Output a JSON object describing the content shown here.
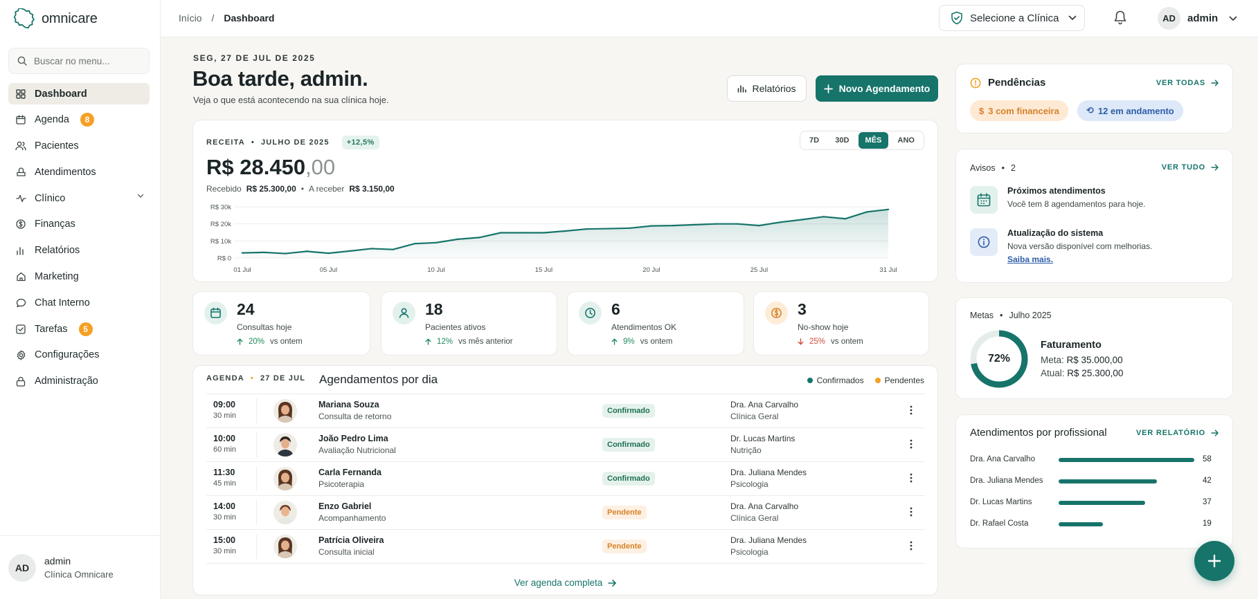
{
  "app": {
    "name": "omnicare"
  },
  "search": {
    "placeholder": "Buscar no menu..."
  },
  "nav": [
    {
      "label": "Dashboard",
      "icon": "grid-icon",
      "active": true
    },
    {
      "label": "Agenda",
      "icon": "calendar-icon",
      "badge": "8"
    },
    {
      "label": "Pacientes",
      "icon": "users-icon"
    },
    {
      "label": "Atendimentos",
      "icon": "stethoscope-icon"
    },
    {
      "label": "Clínico",
      "icon": "activity-icon",
      "expandable": true
    },
    {
      "label": "Finanças",
      "icon": "dollar-icon"
    },
    {
      "label": "Relatórios",
      "icon": "bar-chart-icon"
    },
    {
      "label": "Marketing",
      "icon": "megaphone-icon"
    },
    {
      "label": "Chat Interno",
      "icon": "chat-icon"
    },
    {
      "label": "Tarefas",
      "icon": "checkbox-icon",
      "badge": "5"
    },
    {
      "label": "Configurações",
      "icon": "gear-icon"
    },
    {
      "label": "Administração",
      "icon": "lock-icon"
    }
  ],
  "sidebar_user": {
    "initials": "AD",
    "name": "admin",
    "clinic": "Clínica Omnicare"
  },
  "breadcrumb": {
    "home": "Início",
    "separator": "/",
    "current": "Dashboard"
  },
  "topbar": {
    "clinic_select": "Selecione a Clínica",
    "user_initials": "AD",
    "user_name": "admin"
  },
  "header": {
    "date": "SEG, 27 DE JUL DE 2025",
    "greeting": "Boa tarde, admin.",
    "subtitle": "Veja o que está acontecendo na sua clínica hoje.",
    "reports_button": "Relatórios",
    "new_button": "Novo Agendamento"
  },
  "revenue": {
    "label": "RECEITA",
    "separator": "•",
    "period": "JULHO DE 2025",
    "growth": "+12,5%",
    "periods": [
      "7D",
      "30D",
      "MÊS",
      "ANO"
    ],
    "active_period": "MÊS",
    "amount": "R$ 28.450",
    "amount_cents": ",00",
    "received_label": "Recebido",
    "received_value": "R$ 25.300,00",
    "receivable_label": "A receber",
    "receivable_value": "R$ 3.150,00"
  },
  "chart_data": {
    "type": "area",
    "title": "",
    "xlabel": "",
    "ylabel": "",
    "y_ticks": [
      "R$ 30k",
      "R$ 20k",
      "R$ 10k",
      "R$ 0"
    ],
    "y_tick_values": [
      30000,
      20000,
      10000,
      0
    ],
    "x_ticks": [
      "01 Jul",
      "05 Jul",
      "10 Jul",
      "15 Jul",
      "20 Jul",
      "25 Jul",
      "31 Jul"
    ],
    "x_tick_days": [
      1,
      5,
      10,
      15,
      20,
      25,
      31
    ],
    "ylim": [
      0,
      30000
    ],
    "xlim": [
      1,
      31
    ],
    "grid": true,
    "color": "#16746a",
    "x": [
      1,
      2,
      3,
      4,
      5,
      6,
      7,
      8,
      9,
      10,
      11,
      12,
      13,
      14,
      15,
      16,
      17,
      18,
      19,
      20,
      21,
      22,
      23,
      24,
      25,
      26,
      27,
      28,
      29,
      30,
      31
    ],
    "values": [
      3000,
      3300,
      2600,
      3900,
      2800,
      4100,
      5500,
      5000,
      8400,
      9000,
      11000,
      12000,
      14800,
      14800,
      14800,
      15800,
      17000,
      17200,
      17500,
      18800,
      19000,
      19500,
      20000,
      20000,
      19000,
      21000,
      22500,
      24200,
      23000,
      27000,
      28450
    ]
  },
  "stats": [
    {
      "icon": "calendar-icon",
      "value": "24",
      "label": "Consultas hoje",
      "delta": "20%",
      "direction": "up",
      "compare": "vs ontem",
      "tint": "#e3f1ed",
      "color": "#16746a"
    },
    {
      "icon": "user-icon",
      "value": "18",
      "label": "Pacientes ativos",
      "delta": "12%",
      "direction": "up",
      "compare": "vs mês anterior",
      "tint": "#e3f1ed",
      "color": "#16746a"
    },
    {
      "icon": "clock-icon",
      "value": "6",
      "label": "Atendimentos OK",
      "delta": "9%",
      "direction": "up",
      "compare": "vs ontem",
      "tint": "#e3f1ed",
      "color": "#16746a"
    },
    {
      "icon": "dollar-circle-icon",
      "value": "3",
      "label": "No-show hoje",
      "delta": "25%",
      "direction": "down",
      "compare": "vs ontem",
      "tint": "#fdecd8",
      "color": "#d6822a"
    }
  ],
  "agenda": {
    "label": "AGENDA",
    "separator": "•",
    "date": "27 DE JUL",
    "title": "Agendamentos por dia",
    "legend_confirmed": "Confirmados",
    "legend_pending": "Pendentes",
    "confirmed_color": "#16746a",
    "pending_color": "#f5a025",
    "link": "Ver agenda completa",
    "rows": [
      {
        "time": "09:00",
        "duration": "30 min",
        "name": "Mariana Souza",
        "type": "Consulta de retorno",
        "status": "Confirmado",
        "doctor": "Dra. Ana Carvalho",
        "specialty": "Clínica Geral",
        "avatar": "woman"
      },
      {
        "time": "10:00",
        "duration": "60 min",
        "name": "João Pedro Lima",
        "type": "Avaliação Nutricional",
        "status": "Confirmado",
        "doctor": "Dr. Lucas Martins",
        "specialty": "Nutrição",
        "avatar": "man"
      },
      {
        "time": "11:30",
        "duration": "45 min",
        "name": "Carla Fernanda",
        "type": "Psicoterapia",
        "status": "Confirmado",
        "doctor": "Dra. Juliana Mendes",
        "specialty": "Psicologia",
        "avatar": "woman"
      },
      {
        "time": "14:00",
        "duration": "30 min",
        "name": "Enzo Gabriel",
        "type": "Acompanhamento",
        "status": "Pendente",
        "doctor": "Dra. Ana Carvalho",
        "specialty": "Clínica Geral",
        "avatar": "child"
      },
      {
        "time": "15:00",
        "duration": "30 min",
        "name": "Patrícia Oliveira",
        "type": "Consulta inicial",
        "status": "Pendente",
        "doctor": "Dra. Juliana Mendes",
        "specialty": "Psicologia",
        "avatar": "woman"
      }
    ]
  },
  "pendencias": {
    "title": "Pendências",
    "link": "VER TODAS",
    "finance_pill": "3 com financeira",
    "progress_pill": "12 em andamento"
  },
  "avisos": {
    "label": "Avisos",
    "separator": "•",
    "count": "2",
    "link": "VER TUDO",
    "items": [
      {
        "title": "Próximos atendimentos",
        "desc": "Você tem 8 agendamentos para hoje."
      },
      {
        "title": "Atualização do sistema",
        "desc": "Nova versão disponível com melhorias.",
        "link": "Saiba mais."
      }
    ]
  },
  "metas": {
    "label": "Metas",
    "separator": "•",
    "period": "Julho 2025",
    "percent": "72%",
    "progress": 0.72,
    "title": "Faturamento",
    "goal_label": "Meta:",
    "goal_value": "R$ 35.000,00",
    "current_label": "Atual:",
    "current_value": "R$ 25.300,00"
  },
  "professionals": {
    "title": "Atendimentos por profissional",
    "link": "VER RELATÓRIO",
    "max": 58,
    "items": [
      {
        "name": "Dra. Ana Carvalho",
        "value": 58
      },
      {
        "name": "Dra. Juliana Mendes",
        "value": 42
      },
      {
        "name": "Dr. Lucas Martins",
        "value": 37
      },
      {
        "name": "Dr. Rafael Costa",
        "value": 19
      }
    ]
  }
}
